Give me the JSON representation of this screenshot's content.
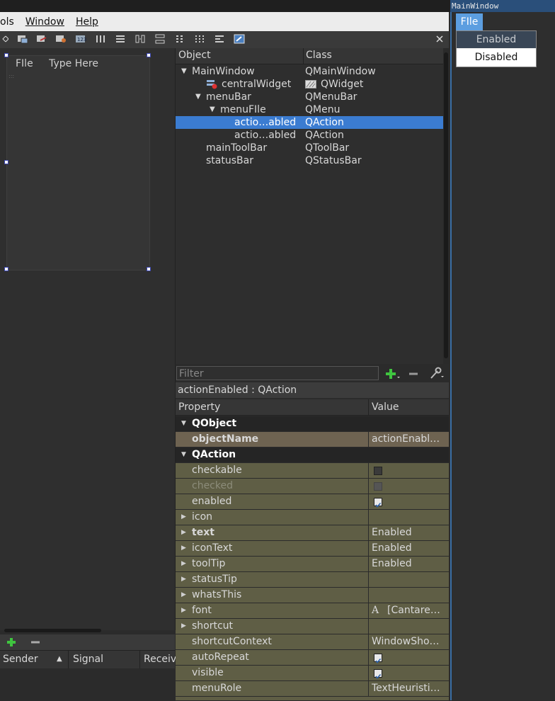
{
  "menubar": {
    "items": [
      "ols",
      "Window",
      "Help"
    ]
  },
  "form": {
    "menu": [
      "FIle",
      "Type Here"
    ]
  },
  "object_inspector": {
    "headers": [
      "Object",
      "Class"
    ],
    "rows": [
      {
        "name": "MainWindow",
        "cls": "QMainWindow"
      },
      {
        "name": "centralWidget",
        "cls": "QWidget"
      },
      {
        "name": "menuBar",
        "cls": "QMenuBar"
      },
      {
        "name": "menuFIle",
        "cls": "QMenu"
      },
      {
        "name": "actio…abled",
        "cls": "QAction"
      },
      {
        "name": "actio…abled",
        "cls": "QAction"
      },
      {
        "name": "mainToolBar",
        "cls": "QToolBar"
      },
      {
        "name": "statusBar",
        "cls": "QStatusBar"
      }
    ]
  },
  "property_editor": {
    "filter_placeholder": "Filter",
    "current_object": "actionEnabled : QAction",
    "headers": [
      "Property",
      "Value"
    ],
    "groups": {
      "qobject": "QObject",
      "qaction": "QAction"
    },
    "props": {
      "objectName": {
        "name": "objectName",
        "value": "actionEnabl…"
      },
      "checkable": {
        "name": "checkable"
      },
      "checked": {
        "name": "checked"
      },
      "enabled": {
        "name": "enabled"
      },
      "icon": {
        "name": "icon",
        "value": ""
      },
      "text": {
        "name": "text",
        "value": "Enabled"
      },
      "iconText": {
        "name": "iconText",
        "value": "Enabled"
      },
      "toolTip": {
        "name": "toolTip",
        "value": "Enabled"
      },
      "statusTip": {
        "name": "statusTip",
        "value": ""
      },
      "whatsThis": {
        "name": "whatsThis",
        "value": ""
      },
      "font": {
        "name": "font",
        "value": "[Cantare…"
      },
      "shortcut": {
        "name": "shortcut",
        "value": ""
      },
      "shortcutContext": {
        "name": "shortcutContext",
        "value": "WindowSho…"
      },
      "autoRepeat": {
        "name": "autoRepeat"
      },
      "visible": {
        "name": "visible"
      },
      "menuRole": {
        "name": "menuRole",
        "value": "TextHeuristi…"
      }
    },
    "checkbox_states": {
      "checkable": false,
      "checked": false,
      "enabled": true,
      "autoRepeat": true,
      "visible": true
    }
  },
  "signal_slot": {
    "headers": [
      "Sender",
      "Signal",
      "Receiv"
    ]
  },
  "preview": {
    "title": "MainWindow",
    "menu": "FIle",
    "actions": [
      "Enabled",
      "Disabled"
    ]
  },
  "colors": {
    "selection": "#3b7cd1",
    "property_bg": "#5f5e45",
    "preview_menu_active": "#5c9ee0"
  }
}
